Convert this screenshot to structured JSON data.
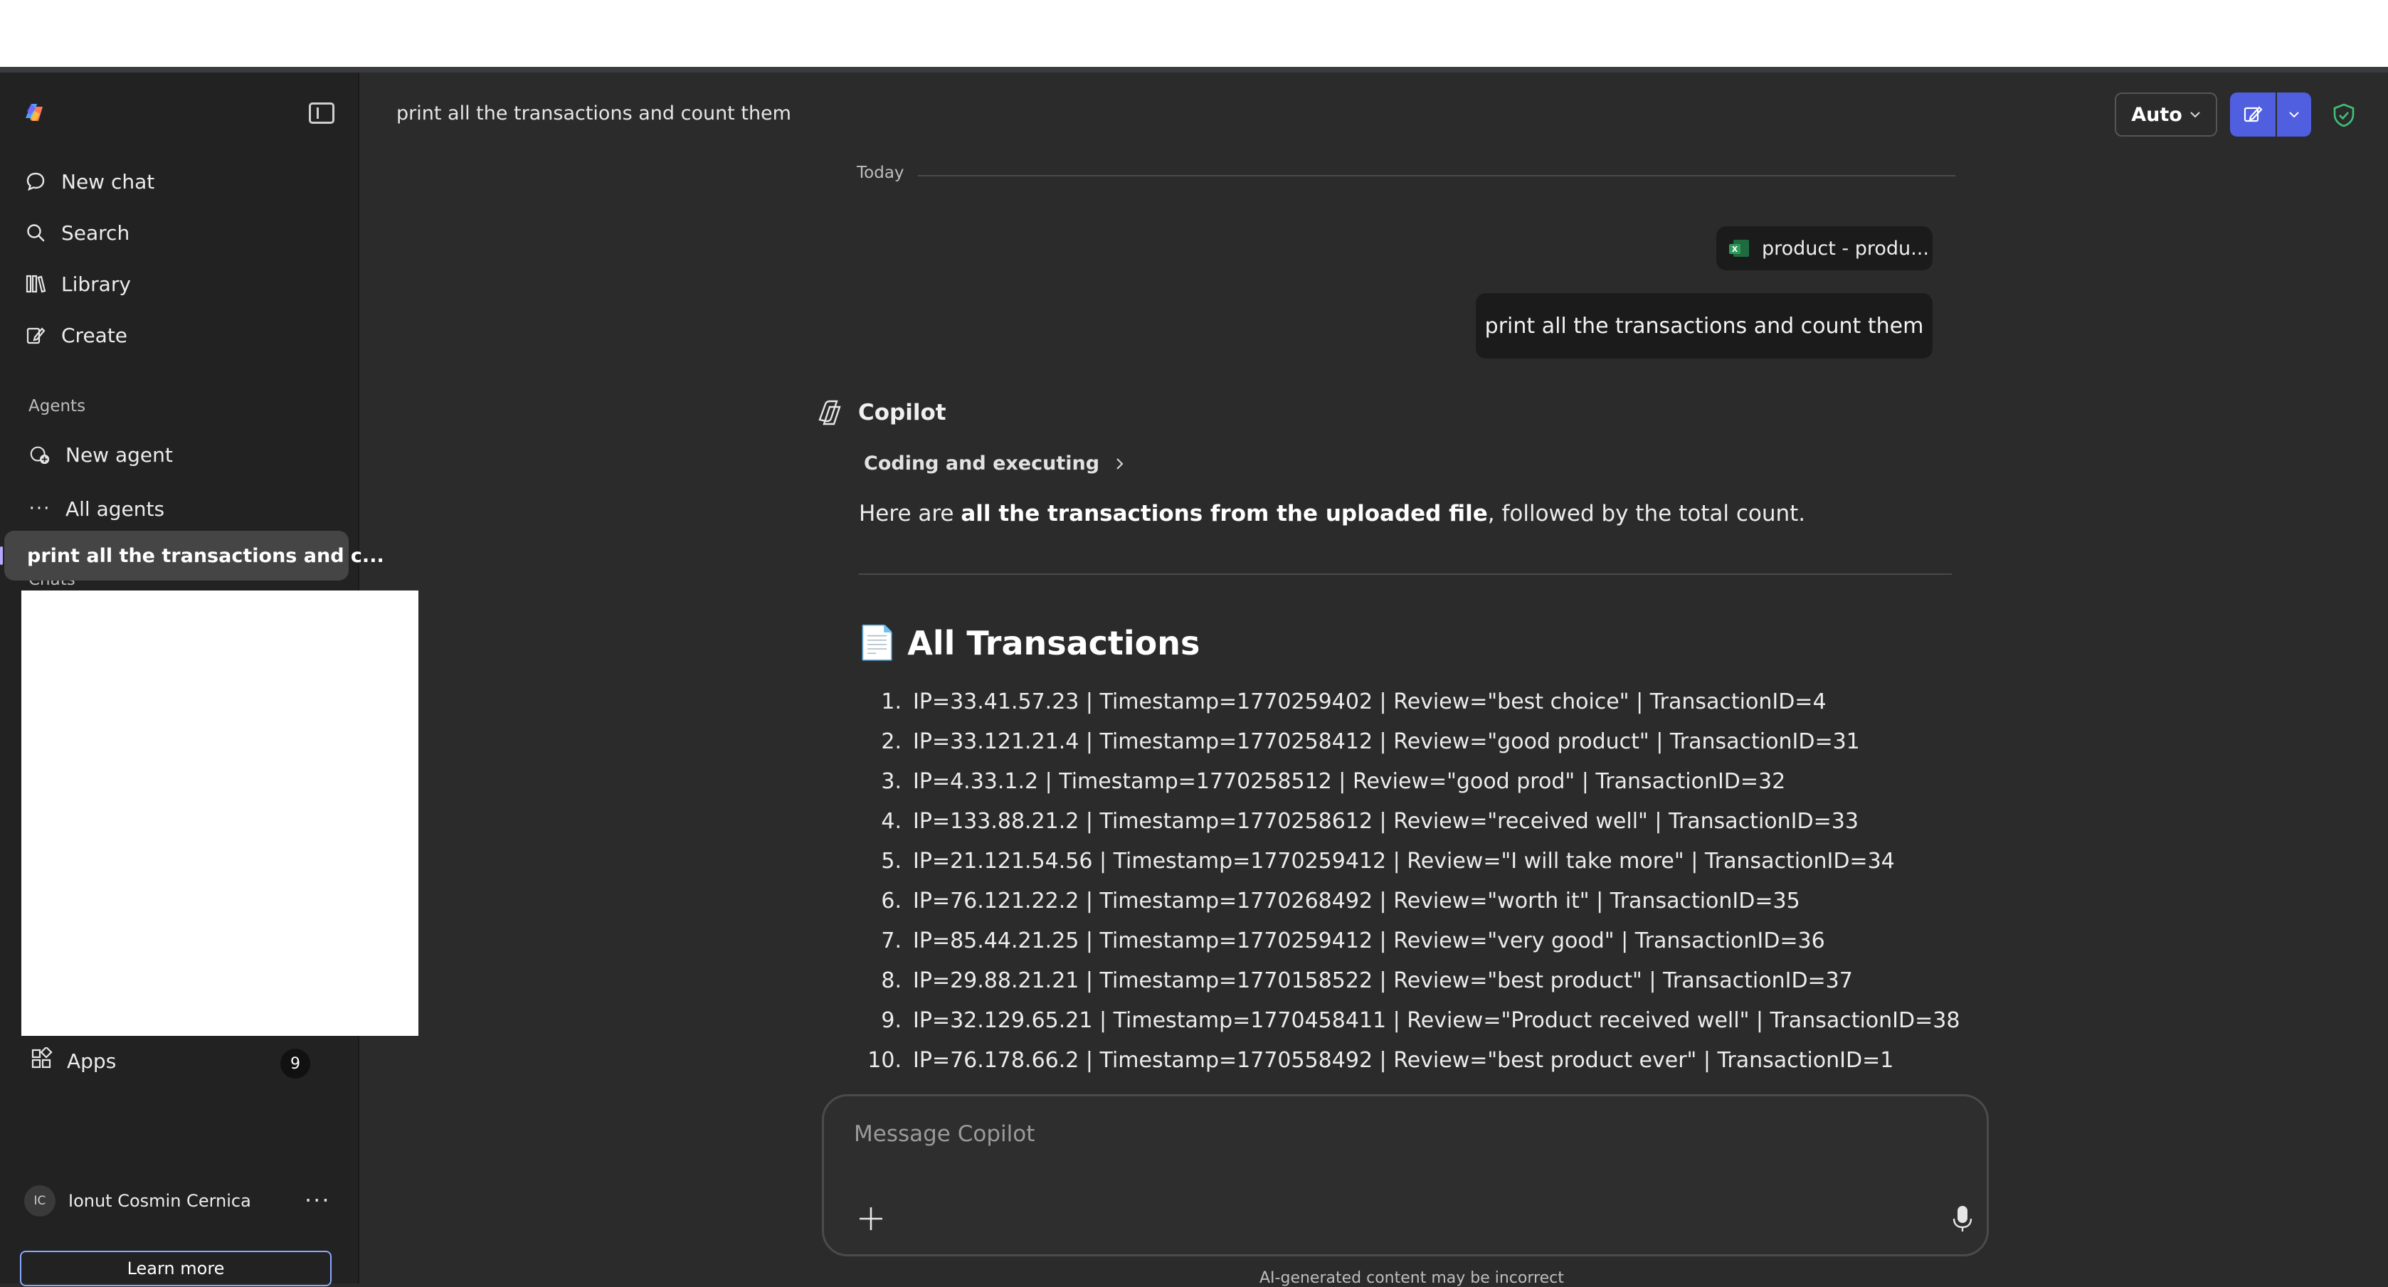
{
  "sidebar": {
    "nav": [
      {
        "label": "New chat",
        "icon": "chat-bubble-icon"
      },
      {
        "label": "Search",
        "icon": "search-icon"
      },
      {
        "label": "Library",
        "icon": "library-icon"
      },
      {
        "label": "Create",
        "icon": "create-icon"
      }
    ],
    "agents_label": "Agents",
    "agents": [
      {
        "label": "New agent",
        "icon": "new-agent-icon"
      },
      {
        "label": "All agents",
        "icon": "more-dots-icon"
      }
    ],
    "chats_label": "Chats",
    "active_chat": "print all the transactions and c...",
    "apps_label": "Apps",
    "apps_count": "9",
    "user_initials": "IC",
    "user_name": "Ionut Cosmin Cernica",
    "user_more": "···",
    "learn_more": "Learn more"
  },
  "header": {
    "title": "print all the transactions and count them",
    "mode_label": "Auto"
  },
  "conversation": {
    "date_label": "Today",
    "file_chip": "product - produ...",
    "user_message": "print all the transactions and count them",
    "assistant_name": "Copilot",
    "status": "Coding and executing",
    "intro_prefix": "Here are ",
    "intro_bold": "all the transactions from the uploaded file",
    "intro_suffix": ", followed by the total count.",
    "section_icon": "📄",
    "section_title": "All Transactions",
    "transactions": [
      {
        "n": "1.",
        "text": "IP=33.41.57.23 | Timestamp=1770259402 | Review=\"best choice\" | TransactionID=4"
      },
      {
        "n": "2.",
        "text": "IP=33.121.21.4 | Timestamp=1770258412 | Review=\"good product\" | TransactionID=31"
      },
      {
        "n": "3.",
        "text": "IP=4.33.1.2 | Timestamp=1770258512 | Review=\"good prod\" | TransactionID=32"
      },
      {
        "n": "4.",
        "text": "IP=133.88.21.2 | Timestamp=1770258612 | Review=\"received well\" | TransactionID=33"
      },
      {
        "n": "5.",
        "text": "IP=21.121.54.56 | Timestamp=1770259412 | Review=\"I will take more\" | TransactionID=34"
      },
      {
        "n": "6.",
        "text": "IP=76.121.22.2 | Timestamp=1770268492 | Review=\"worth it\" | TransactionID=35"
      },
      {
        "n": "7.",
        "text": "IP=85.44.21.25 | Timestamp=1770259412 | Review=\"very good\" | TransactionID=36"
      },
      {
        "n": "8.",
        "text": "IP=29.88.21.21 | Timestamp=1770158522 | Review=\"best product\" | TransactionID=37"
      },
      {
        "n": "9.",
        "text": "IP=32.129.65.21 | Timestamp=1770458411 | Review=\"Product received well\" | TransactionID=38"
      },
      {
        "n": "10.",
        "text": "IP=76.178.66.2 | Timestamp=1770558492 | Review=\"best product ever\" | TransactionID=1"
      }
    ]
  },
  "composer": {
    "placeholder": "Message Copilot",
    "value": ""
  },
  "disclaimer": "AI-generated content may be incorrect",
  "colors": {
    "background": "#2b2b2b",
    "sidebar": "#222222",
    "accent": "#4f5fe0",
    "bubble": "#1b1b1b"
  }
}
